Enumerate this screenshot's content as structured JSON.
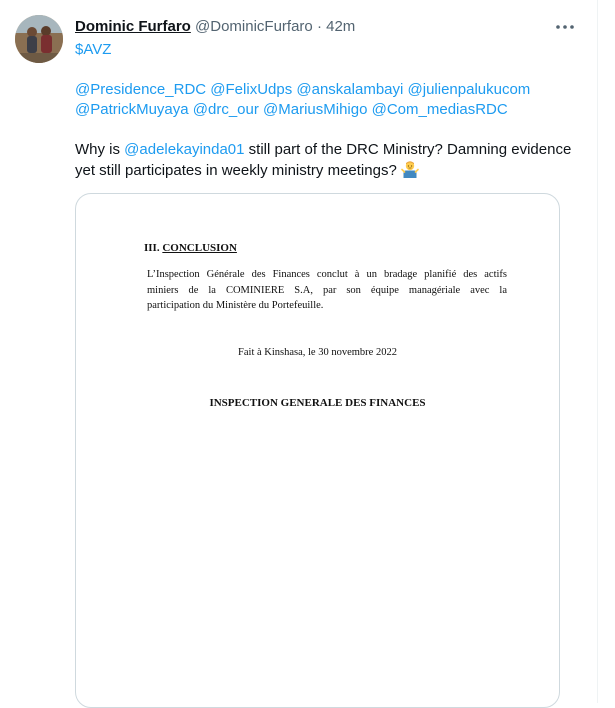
{
  "tweet": {
    "display_name": "Dominic Furfaro",
    "handle": "@DominicFurfaro",
    "separator": "·",
    "time": "42m",
    "more_icon": "more-dots-icon",
    "cashtag": "$AVZ",
    "mentions_line1": [
      "@Presidence_RDC",
      "@FelixUdps",
      "@anskalambayi",
      "@julienpalukucom"
    ],
    "mentions_line2": [
      "@PatrickMuyaya",
      "@drc_our",
      "@MariusMihigo",
      "@Com_mediasRDC"
    ],
    "text_before_mention": "Why is ",
    "inline_mention": "@adelekayinda01",
    "text_after_mention": " still part of the DRC Ministry? Damning evidence yet still participates in weekly ministry meetings? ",
    "emoji": "man-shrugging-emoji"
  },
  "document": {
    "section_number": "III.",
    "section_title": "CONCLUSION",
    "paragraph_lines": [
      "L’Inspection Générale des Finances conclut à un bradage planifié des actifs",
      "miniers de la COMINIERE S.A, par son équipe managériale avec la",
      "participation du Ministère du Portefeuille."
    ],
    "place_date": "Fait à Kinshasa, le 30 novembre 2022",
    "organization": "INSPECTION GENERALE DES FINANCES"
  },
  "colors": {
    "link": "#1d9bf0",
    "text": "#0f1419",
    "secondary": "#536471",
    "border": "#cfd9de"
  }
}
